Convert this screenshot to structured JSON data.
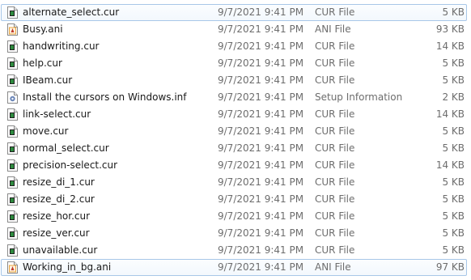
{
  "file_list": {
    "files": [
      {
        "name": "alternate_select.cur",
        "date": "9/7/2021 9:41 PM",
        "type": "CUR File",
        "size": "5 KB",
        "icon": "cursor-file-icon",
        "selected": true
      },
      {
        "name": "Busy.ani",
        "date": "9/7/2021 9:41 PM",
        "type": "ANI File",
        "size": "93 KB",
        "icon": "animated-cursor-file-icon",
        "selected": false
      },
      {
        "name": "handwriting.cur",
        "date": "9/7/2021 9:41 PM",
        "type": "CUR File",
        "size": "14 KB",
        "icon": "cursor-file-icon",
        "selected": false
      },
      {
        "name": "help.cur",
        "date": "9/7/2021 9:41 PM",
        "type": "CUR File",
        "size": "5 KB",
        "icon": "cursor-file-icon",
        "selected": false
      },
      {
        "name": "IBeam.cur",
        "date": "9/7/2021 9:41 PM",
        "type": "CUR File",
        "size": "5 KB",
        "icon": "cursor-file-icon",
        "selected": false
      },
      {
        "name": "Install the cursors on Windows.inf",
        "date": "9/7/2021 9:41 PM",
        "type": "Setup Information",
        "size": "2 KB",
        "icon": "setup-information-file-icon",
        "selected": false
      },
      {
        "name": "link-select.cur",
        "date": "9/7/2021 9:41 PM",
        "type": "CUR File",
        "size": "14 KB",
        "icon": "cursor-file-icon",
        "selected": false
      },
      {
        "name": "move.cur",
        "date": "9/7/2021 9:41 PM",
        "type": "CUR File",
        "size": "5 KB",
        "icon": "cursor-file-icon",
        "selected": false
      },
      {
        "name": "normal_select.cur",
        "date": "9/7/2021 9:41 PM",
        "type": "CUR File",
        "size": "5 KB",
        "icon": "cursor-file-icon",
        "selected": false
      },
      {
        "name": "precision-select.cur",
        "date": "9/7/2021 9:41 PM",
        "type": "CUR File",
        "size": "14 KB",
        "icon": "cursor-file-icon",
        "selected": false
      },
      {
        "name": "resize_di_1.cur",
        "date": "9/7/2021 9:41 PM",
        "type": "CUR File",
        "size": "5 KB",
        "icon": "cursor-file-icon",
        "selected": false
      },
      {
        "name": "resize_di_2.cur",
        "date": "9/7/2021 9:41 PM",
        "type": "CUR File",
        "size": "5 KB",
        "icon": "cursor-file-icon",
        "selected": false
      },
      {
        "name": "resize_hor.cur",
        "date": "9/7/2021 9:41 PM",
        "type": "CUR File",
        "size": "5 KB",
        "icon": "cursor-file-icon",
        "selected": false
      },
      {
        "name": "resize_ver.cur",
        "date": "9/7/2021 9:41 PM",
        "type": "CUR File",
        "size": "5 KB",
        "icon": "cursor-file-icon",
        "selected": false
      },
      {
        "name": "unavailable.cur",
        "date": "9/7/2021 9:41 PM",
        "type": "CUR File",
        "size": "5 KB",
        "icon": "cursor-file-icon",
        "selected": false
      },
      {
        "name": "Working_in_bg.ani",
        "date": "9/7/2021 9:41 PM",
        "type": "ANI File",
        "size": "97 KB",
        "icon": "animated-cursor-file-icon",
        "selected": true
      }
    ]
  },
  "colors": {
    "selection_border": "#a8c7e8",
    "secondary_text": "#6d6d6d",
    "cursor_icon_accent": "#2e8b3f",
    "ani_icon_accent": "#e8a33c",
    "inf_icon_accent": "#6b86b8"
  }
}
